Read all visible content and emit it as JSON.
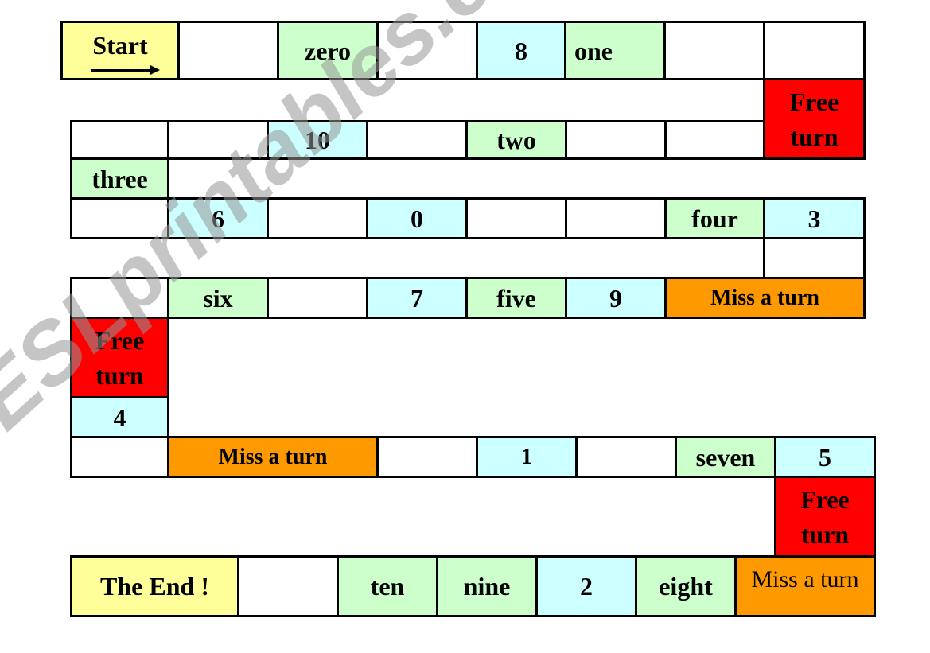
{
  "colors": {
    "yellow": "#ffff99",
    "green": "#ccffcc",
    "blue": "#ccffff",
    "red": "#ff0000",
    "orange": "#ff9900",
    "white": "#ffffff"
  },
  "watermark": "ESLprintables.com",
  "cells": [
    {
      "text": "Start",
      "color": "yellow",
      "icon": "arrow-right-icon"
    },
    {
      "text": "",
      "color": "white"
    },
    {
      "text": "zero",
      "color": "green"
    },
    {
      "text": "",
      "color": "white"
    },
    {
      "text": "8",
      "color": "blue"
    },
    {
      "text": "one",
      "color": "green"
    },
    {
      "text": "",
      "color": "white"
    },
    {
      "text": "",
      "color": "white"
    },
    {
      "text": "Free\nturn",
      "color": "red"
    },
    {
      "text": "",
      "color": "white"
    },
    {
      "text": "",
      "color": "white"
    },
    {
      "text": "10",
      "color": "blue"
    },
    {
      "text": "",
      "color": "white"
    },
    {
      "text": "two",
      "color": "green"
    },
    {
      "text": "",
      "color": "white"
    },
    {
      "text": "",
      "color": "white"
    },
    {
      "text": "three",
      "color": "green"
    },
    {
      "text": "",
      "color": "white"
    },
    {
      "text": "6",
      "color": "blue"
    },
    {
      "text": "",
      "color": "white"
    },
    {
      "text": "0",
      "color": "blue"
    },
    {
      "text": "",
      "color": "white"
    },
    {
      "text": "",
      "color": "white"
    },
    {
      "text": "four",
      "color": "green"
    },
    {
      "text": "3",
      "color": "blue"
    },
    {
      "text": "",
      "color": "white"
    },
    {
      "text": "",
      "color": "white"
    },
    {
      "text": "six",
      "color": "green"
    },
    {
      "text": "",
      "color": "white"
    },
    {
      "text": "7",
      "color": "blue"
    },
    {
      "text": "five",
      "color": "green"
    },
    {
      "text": "9",
      "color": "blue"
    },
    {
      "text": "Miss a turn",
      "color": "orange"
    },
    {
      "text": "Free\nturn",
      "color": "red"
    },
    {
      "text": "4",
      "color": "blue"
    },
    {
      "text": "",
      "color": "white"
    },
    {
      "text": "Miss a turn",
      "color": "orange"
    },
    {
      "text": "",
      "color": "white"
    },
    {
      "text": "1",
      "color": "blue"
    },
    {
      "text": "",
      "color": "white"
    },
    {
      "text": "seven",
      "color": "green"
    },
    {
      "text": "5",
      "color": "blue"
    },
    {
      "text": "Free\nturn",
      "color": "red"
    },
    {
      "text": "The End !",
      "color": "yellow"
    },
    {
      "text": "",
      "color": "white"
    },
    {
      "text": "ten",
      "color": "green"
    },
    {
      "text": "nine",
      "color": "green"
    },
    {
      "text": "2",
      "color": "blue"
    },
    {
      "text": "eight",
      "color": "green"
    },
    {
      "text": "Miss a turn",
      "color": "orange"
    }
  ]
}
